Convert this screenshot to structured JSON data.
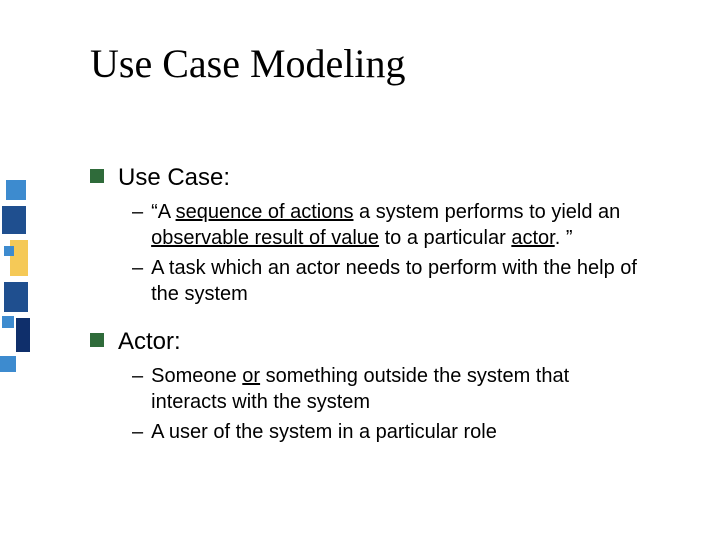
{
  "title": "Use Case Modeling",
  "colors": {
    "bullet_square": "#2f6b3a",
    "deco1": "#3d8bcf",
    "deco2": "#1f4f8f",
    "deco3": "#f5c957",
    "deco4": "#0f2f6b"
  },
  "sections": [
    {
      "heading": "Use Case:",
      "items": [
        {
          "prefix": "“A ",
          "u1": "sequence of actions",
          "mid1": " a system performs to yield an ",
          "u2": "observable result of value",
          "mid2": " to a particular ",
          "u3": "actor",
          "suffix": ". ”"
        },
        {
          "plain": "A task which an actor needs to perform with the help of the system"
        }
      ]
    },
    {
      "heading": "Actor:",
      "items": [
        {
          "prefix": "Someone ",
          "u1": "or",
          "mid1": " something outside the system that interacts with the system"
        },
        {
          "plain": "A user of the system in a particular role"
        }
      ]
    }
  ],
  "dash": "–"
}
